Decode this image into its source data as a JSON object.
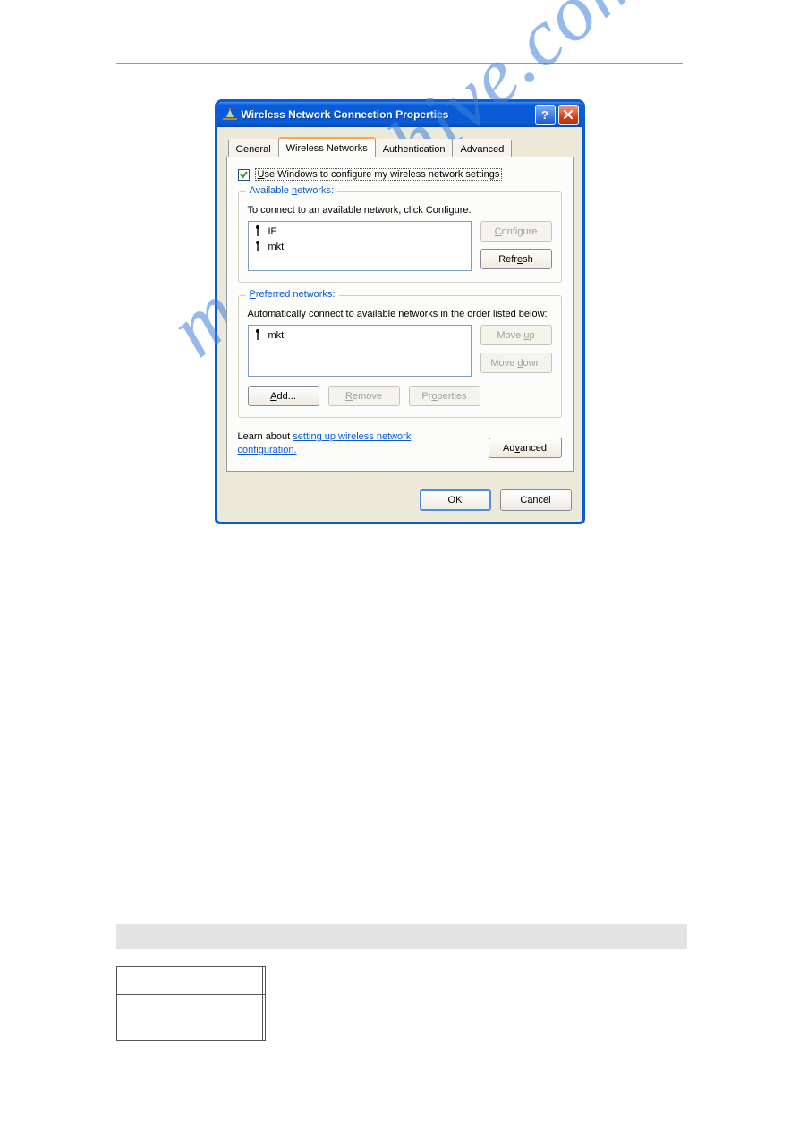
{
  "dialog": {
    "title": "Wireless Network Connection Properties",
    "tabs": [
      "General",
      "Wireless Networks",
      "Authentication",
      "Advanced"
    ],
    "active_tab_index": 1,
    "checkbox": {
      "checked": true,
      "label_prefix": "U",
      "label_rest": "se Windows to configure my wireless network settings"
    },
    "available": {
      "legend_pre": "Available ",
      "legend_u": "n",
      "legend_post": "etworks:",
      "desc": "To connect to an available network, click Configure.",
      "items": [
        "IE",
        "mkt"
      ],
      "configure_u": "C",
      "configure_rest": "onfigure",
      "refresh_pre": "Refr",
      "refresh_u": "e",
      "refresh_post": "sh"
    },
    "preferred": {
      "legend_u": "P",
      "legend_rest": "referred networks:",
      "desc": "Automatically connect to available networks in the order listed below:",
      "items": [
        "mkt"
      ],
      "moveup_pre": "Move ",
      "moveup_u": "u",
      "moveup_post": "p",
      "movedn_pre": "Move ",
      "movedn_u": "d",
      "movedn_post": "own",
      "add_u": "A",
      "add_rest": "dd...",
      "remove_u": "R",
      "remove_rest": "emove",
      "props_pre": "Pr",
      "props_u": "o",
      "props_post": "perties"
    },
    "learn": {
      "prefix": "Learn about ",
      "link": "setting up wireless network configuration."
    },
    "advanced_pre": "Ad",
    "advanced_u": "v",
    "advanced_post": "anced",
    "ok": "OK",
    "cancel": "Cancel"
  },
  "watermark": "manualshive.com"
}
